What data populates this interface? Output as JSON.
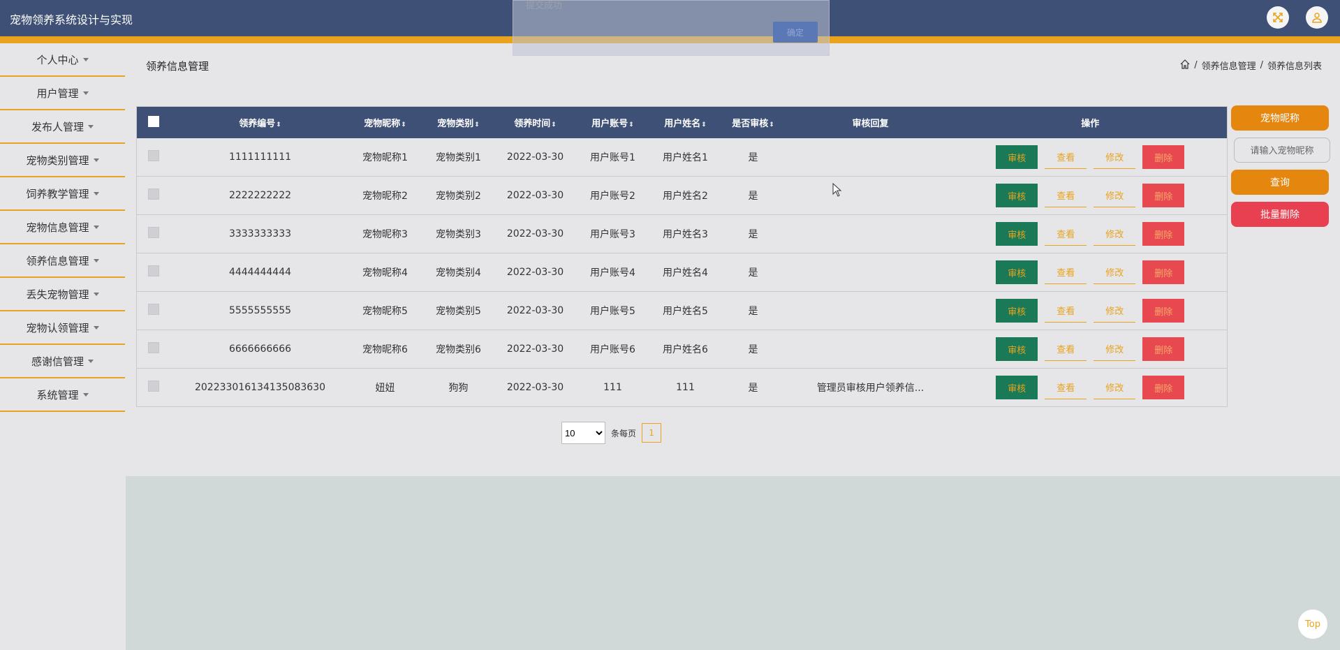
{
  "app": {
    "title": "宠物领养系统设计与实现"
  },
  "toast": {
    "message": "提交成功",
    "confirm": "确定"
  },
  "sidebar": {
    "items": [
      {
        "label": "个人中心"
      },
      {
        "label": "用户管理"
      },
      {
        "label": "发布人管理"
      },
      {
        "label": "宠物类别管理"
      },
      {
        "label": "饲养教学管理"
      },
      {
        "label": "宠物信息管理"
      },
      {
        "label": "领养信息管理"
      },
      {
        "label": "丢失宠物管理"
      },
      {
        "label": "宠物认领管理"
      },
      {
        "label": "感谢信管理"
      },
      {
        "label": "系统管理"
      }
    ]
  },
  "page": {
    "title": "领养信息管理"
  },
  "breadcrumb": {
    "sep": "/",
    "level1": "领养信息管理",
    "level2": "领养信息列表"
  },
  "table": {
    "headers": {
      "id": "领养编号",
      "nickname": "宠物昵称",
      "category": "宠物类别",
      "time": "领养时间",
      "account": "用户账号",
      "name": "用户姓名",
      "audited": "是否审核",
      "reply": "审核回复",
      "ops": "操作"
    },
    "sort_glyph": "⇕",
    "actions": {
      "audit": "审核",
      "view": "查看",
      "edit": "修改",
      "delete": "删除"
    },
    "rows": [
      {
        "id": "1111111111",
        "nickname": "宠物昵称1",
        "category": "宠物类别1",
        "time": "2022-03-30",
        "account": "用户账号1",
        "name": "用户姓名1",
        "audited": "是",
        "reply": ""
      },
      {
        "id": "2222222222",
        "nickname": "宠物昵称2",
        "category": "宠物类别2",
        "time": "2022-03-30",
        "account": "用户账号2",
        "name": "用户姓名2",
        "audited": "是",
        "reply": ""
      },
      {
        "id": "3333333333",
        "nickname": "宠物昵称3",
        "category": "宠物类别3",
        "time": "2022-03-30",
        "account": "用户账号3",
        "name": "用户姓名3",
        "audited": "是",
        "reply": ""
      },
      {
        "id": "4444444444",
        "nickname": "宠物昵称4",
        "category": "宠物类别4",
        "time": "2022-03-30",
        "account": "用户账号4",
        "name": "用户姓名4",
        "audited": "是",
        "reply": ""
      },
      {
        "id": "5555555555",
        "nickname": "宠物昵称5",
        "category": "宠物类别5",
        "time": "2022-03-30",
        "account": "用户账号5",
        "name": "用户姓名5",
        "audited": "是",
        "reply": ""
      },
      {
        "id": "6666666666",
        "nickname": "宠物昵称6",
        "category": "宠物类别6",
        "time": "2022-03-30",
        "account": "用户账号6",
        "name": "用户姓名6",
        "audited": "是",
        "reply": ""
      },
      {
        "id": "202233016134135083630",
        "nickname": "妞妞",
        "category": "狗狗",
        "time": "2022-03-30",
        "account": "111",
        "name": "111",
        "audited": "是",
        "reply": "管理员审核用户领养信..."
      }
    ]
  },
  "pager": {
    "page_size": "10",
    "per_page_label": "条每页",
    "current": "1"
  },
  "search": {
    "label": "宠物昵称",
    "placeholder": "请输入宠物昵称",
    "query": "查询",
    "batch_delete": "批量删除"
  },
  "back_to_top": "Top",
  "colors": {
    "header": "#3e5075",
    "accent": "#e9a31c",
    "audit": "#1a7a57",
    "danger": "#e84850"
  }
}
